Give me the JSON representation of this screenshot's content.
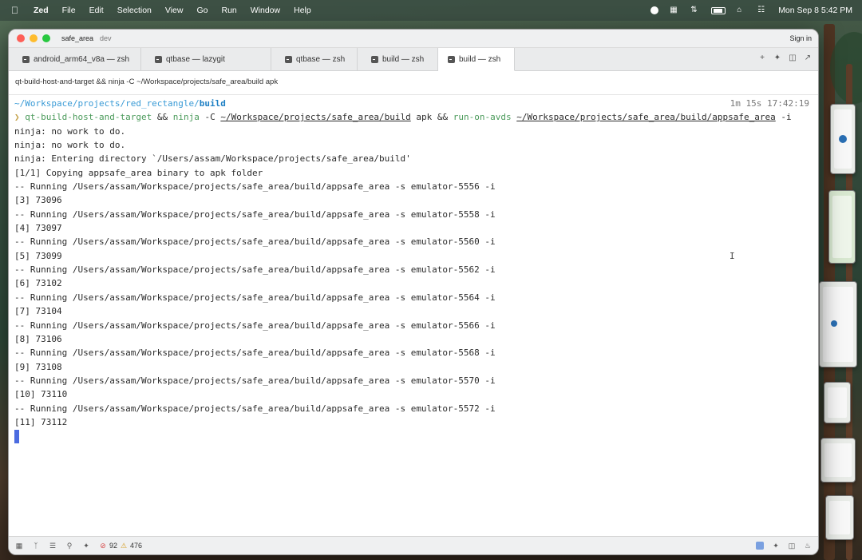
{
  "menubar": {
    "app_name": "Zed",
    "items": [
      "File",
      "Edit",
      "Selection",
      "View",
      "Go",
      "Run",
      "Window",
      "Help"
    ],
    "clock": "Mon Sep 8  5:42 PM"
  },
  "window": {
    "project": "safe_area",
    "branch": "dev",
    "sign_in": "Sign in"
  },
  "tabs": [
    {
      "label": "android_arm64_v8a — zsh",
      "active": false
    },
    {
      "label": "qtbase — lazygit",
      "active": false
    },
    {
      "label": "qtbase — zsh",
      "active": false
    },
    {
      "label": "build — zsh",
      "active": false
    },
    {
      "label": "build — zsh",
      "active": true
    }
  ],
  "command_bar": "qt-build-host-and-target && ninja -C ~/Workspace/projects/safe_area/build apk",
  "terminal": {
    "cwd_prefix": "~/Workspace/projects/red_rectangle/",
    "cwd_dir": "build",
    "timing": "1m 15s 17:42:19",
    "prompt": {
      "arrow": "❯",
      "cmd1": "qt-build-host-and-target",
      "op1": " && ",
      "cmd2": "ninja",
      "args2a": " -C ",
      "path2": "~/Workspace/projects/safe_area/build",
      "args2b": " apk ",
      "op2": "&& ",
      "cmd3": "run-on-avds",
      "space": " ",
      "path3": "~/Workspace/projects/safe_area/build/appsafe_area",
      "args3": " -i"
    },
    "lines": [
      "ninja: no work to do.",
      "ninja: no work to do.",
      "ninja: Entering directory `/Users/assam/Workspace/projects/safe_area/build'",
      "[1/1] Copying appsafe_area binary to apk folder",
      "-- Running /Users/assam/Workspace/projects/safe_area/build/appsafe_area -s emulator-5556 -i",
      "[3] 73096",
      "-- Running /Users/assam/Workspace/projects/safe_area/build/appsafe_area -s emulator-5558 -i",
      "[4] 73097",
      "-- Running /Users/assam/Workspace/projects/safe_area/build/appsafe_area -s emulator-5560 -i",
      "[5] 73099",
      "-- Running /Users/assam/Workspace/projects/safe_area/build/appsafe_area -s emulator-5562 -i",
      "[6] 73102",
      "-- Running /Users/assam/Workspace/projects/safe_area/build/appsafe_area -s emulator-5564 -i",
      "[7] 73104",
      "-- Running /Users/assam/Workspace/projects/safe_area/build/appsafe_area -s emulator-5566 -i",
      "[8] 73106",
      "-- Running /Users/assam/Workspace/projects/safe_area/build/appsafe_area -s emulator-5568 -i",
      "[9] 73108",
      "-- Running /Users/assam/Workspace/projects/safe_area/build/appsafe_area -s emulator-5570 -i",
      "[10] 73110",
      "-- Running /Users/assam/Workspace/projects/safe_area/build/appsafe_area -s emulator-5572 -i",
      "[11] 73112"
    ]
  },
  "statusbar": {
    "errors": "92",
    "warnings": "476"
  },
  "colors": {
    "path_blue": "#3a9bd6",
    "command_green": "#4a9a5a",
    "prompt_yellow": "#c5a24a",
    "cursor_blue": "#4b6be0",
    "error_red": "#d64545",
    "warning_amber": "#d49a19"
  }
}
